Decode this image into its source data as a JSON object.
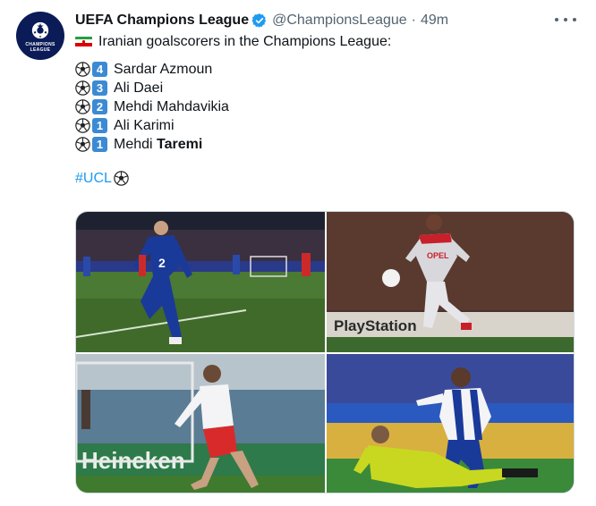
{
  "account": {
    "name": "UEFA Champions League",
    "handle": "@ChampionsLeague",
    "separator": "·",
    "time": "49m",
    "avatar_text_1": "CHAMPIONS",
    "avatar_text_2": "LEAGUE"
  },
  "tweet": {
    "intro": "Iranian goalscorers in the Champions League:",
    "scorers": [
      {
        "goals": "4",
        "first": "Sardar Azmoun",
        "bold": ""
      },
      {
        "goals": "3",
        "first": "Ali Daei",
        "bold": ""
      },
      {
        "goals": "2",
        "first": "Mehdi Mahdavikia",
        "bold": ""
      },
      {
        "goals": "1",
        "first": "Ali Karimi",
        "bold": ""
      },
      {
        "goals": "1",
        "first": "Mehdi ",
        "bold": "Taremi"
      }
    ],
    "hashtag": "#UCL"
  },
  "photos": {
    "p2_ad": "PlayStation",
    "p2_shirt": "OPEL",
    "p3_ad": "Heineken",
    "p1_number": "2"
  },
  "colors": {
    "accent": "#1d9bf0",
    "verified": "#1d9bf0",
    "keycap": "#3c8ad4"
  },
  "icons": [
    "verified-badge-icon",
    "more-options-icon",
    "iran-flag-icon",
    "soccer-ball-icon",
    "keycap-number-icon"
  ]
}
